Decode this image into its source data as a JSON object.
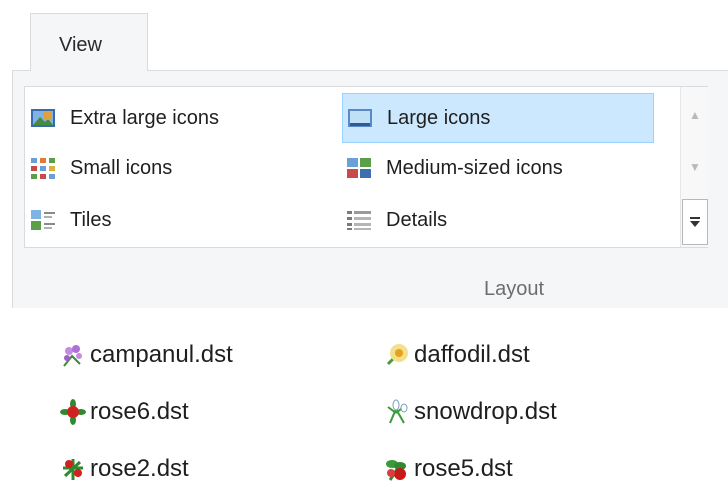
{
  "tabs": {
    "view_label": "View"
  },
  "layout": {
    "group_label": "Layout",
    "options": [
      {
        "label": "Extra large icons",
        "icon": "extra-large-icons-icon"
      },
      {
        "label": "Large icons",
        "icon": "large-icons-icon",
        "selected": true
      },
      {
        "label": "Small icons",
        "icon": "small-icons-icon"
      },
      {
        "label": "Medium-sized icons",
        "icon": "medium-icons-icon"
      },
      {
        "label": "Tiles",
        "icon": "tiles-icon"
      },
      {
        "label": "Details",
        "icon": "details-icon"
      }
    ],
    "scroll_up_glyph": "▲",
    "scroll_down_glyph": "▼",
    "more_glyph": "⏷"
  },
  "files": [
    {
      "name": "campanul.dst",
      "icon": "campanula-flower-icon"
    },
    {
      "name": "daffodil.dst",
      "icon": "daffodil-flower-icon"
    },
    {
      "name": "rose6.dst",
      "icon": "rose-flower-icon"
    },
    {
      "name": "snowdrop.dst",
      "icon": "snowdrop-flower-icon"
    },
    {
      "name": "rose2.dst",
      "icon": "rose-flower-icon"
    },
    {
      "name": "rose5.dst",
      "icon": "rose-flower-icon"
    }
  ],
  "colors": {
    "selected_bg": "#cce8ff",
    "selected_border": "#99d1ff",
    "ribbon_bg": "#f5f6f7"
  }
}
